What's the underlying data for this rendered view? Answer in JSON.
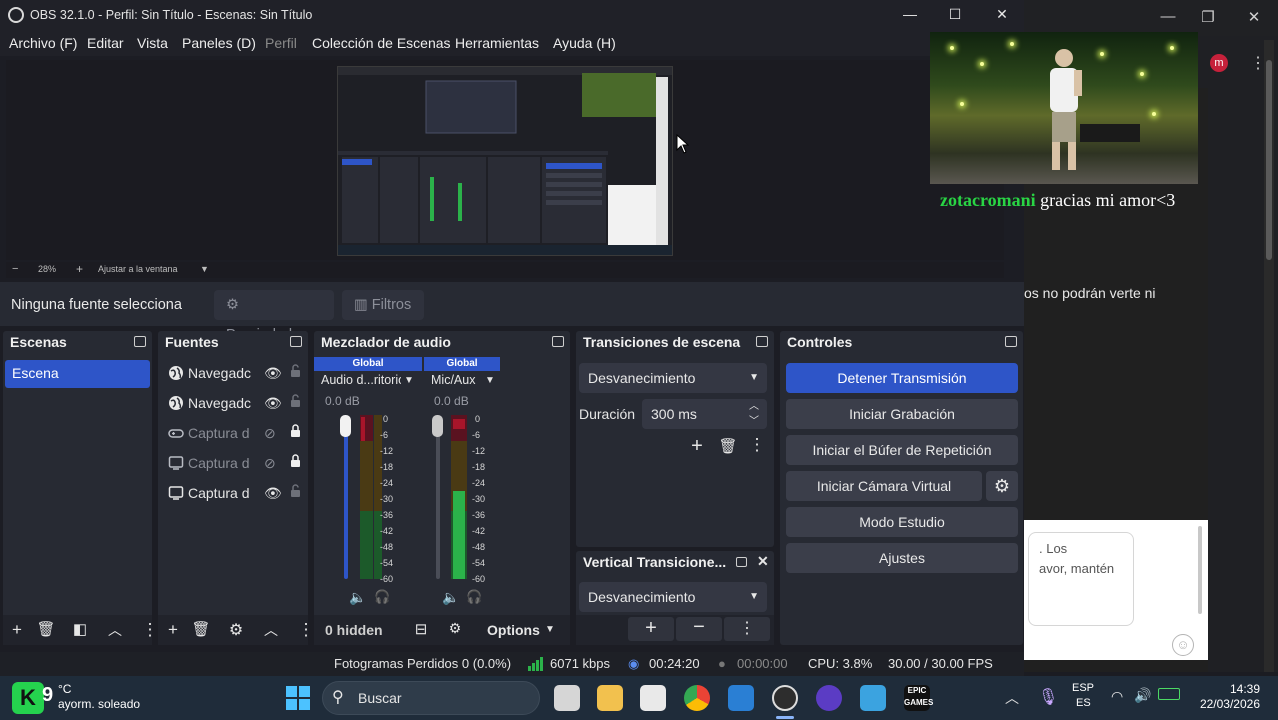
{
  "window": {
    "title": "OBS 32.1.0 - Perfil: Sin Título - Escenas: Sin Título",
    "minimize": "—",
    "maximize": "☐",
    "close": "✕"
  },
  "menu": [
    {
      "label": "Archivo (F)",
      "enabled": true
    },
    {
      "label": "Editar",
      "enabled": true
    },
    {
      "label": "Vista",
      "enabled": true
    },
    {
      "label": "Paneles (D)",
      "enabled": true
    },
    {
      "label": "Perfil",
      "enabled": false
    },
    {
      "label": "Colección de Escenas",
      "enabled": true
    },
    {
      "label": "Herramientas",
      "enabled": true
    },
    {
      "label": "Ayuda (H)",
      "enabled": true
    }
  ],
  "preview": {
    "zoom_minus": "−",
    "zoom_value": "28%",
    "zoom_plus": "+",
    "fit_label": "Ajustar a la ventana"
  },
  "context_bar": {
    "no_source": "Ninguna fuente selecciona",
    "properties": "Propiedades",
    "filters": "Filtros"
  },
  "scenes": {
    "title": "Escenas",
    "items": [
      {
        "label": "Escena",
        "selected": true
      }
    ]
  },
  "sources": {
    "title": "Fuentes",
    "items": [
      {
        "label": "Navegadc",
        "icon": "globe-icon",
        "visible": true,
        "locked": false
      },
      {
        "label": "Navegadc",
        "icon": "globe-icon",
        "visible": true,
        "locked": false
      },
      {
        "label": "Captura d",
        "icon": "gamepad-icon",
        "visible": false,
        "locked": true
      },
      {
        "label": "Captura d",
        "icon": "monitor-icon",
        "visible": false,
        "locked": true
      },
      {
        "label": "Captura d",
        "icon": "monitor-icon",
        "visible": true,
        "locked": false
      }
    ]
  },
  "mixer": {
    "title": "Mezclador de audio",
    "channels": [
      {
        "tag": "Global",
        "name": "Audio d...ritorio",
        "db": "0.0 dB"
      },
      {
        "tag": "Global",
        "name": "Mic/Aux",
        "db": "0.0 dB"
      }
    ],
    "ticks": [
      "0",
      "-6",
      "-12",
      "-18",
      "-24",
      "-30",
      "-36",
      "-42",
      "-48",
      "-54",
      "-60"
    ],
    "hidden": "0 hidden",
    "options": "Options"
  },
  "transitions": {
    "title": "Transiciones de escena",
    "selected": "Desvanecimiento",
    "duration_label": "Duración",
    "duration_value": "300 ms"
  },
  "vertical_transitions": {
    "title": "Vertical Transicione...",
    "selected": "Desvanecimiento"
  },
  "controls": {
    "title": "Controles",
    "stop_stream": "Detener Transmisión",
    "start_recording": "Iniciar Grabación",
    "replay_buffer": "Iniciar el Búfer de Repetición",
    "virtual_cam": "Iniciar Cámara Virtual",
    "studio_mode": "Modo Estudio",
    "settings": "Ajustes"
  },
  "status": {
    "dropped_frames": "Fotogramas Perdidos 0 (0.0%)",
    "bitrate": "6071 kbps",
    "stream_time": "00:24:20",
    "rec_time": "00:00:00",
    "cpu": "CPU: 3.8%",
    "fps": "30.00 / 30.00 FPS"
  },
  "overlay": {
    "username": "zotacromani",
    "message": "gracias mi amor<3"
  },
  "background_window": {
    "avatar_letter": "m",
    "text_fragment": "os no podrán verte ni",
    "chat_line1": ". Los",
    "chat_line2": "avor, mantén"
  },
  "taskbar": {
    "weather_badge": "K",
    "weather_num": "9",
    "weather_temp": "°C",
    "weather_desc": "ayorm. soleado",
    "search_placeholder": "Buscar",
    "lang_top": "ESP",
    "lang_bottom": "ES",
    "time": "14:39",
    "date": "22/03/2026"
  },
  "colors": {
    "accent": "#2e55c8",
    "dock_bg": "#272a33",
    "window_bg": "#1c1d24",
    "overlay_user": "#29d444",
    "meter_green": "#2bb24a",
    "meter_red": "#a8152a"
  }
}
